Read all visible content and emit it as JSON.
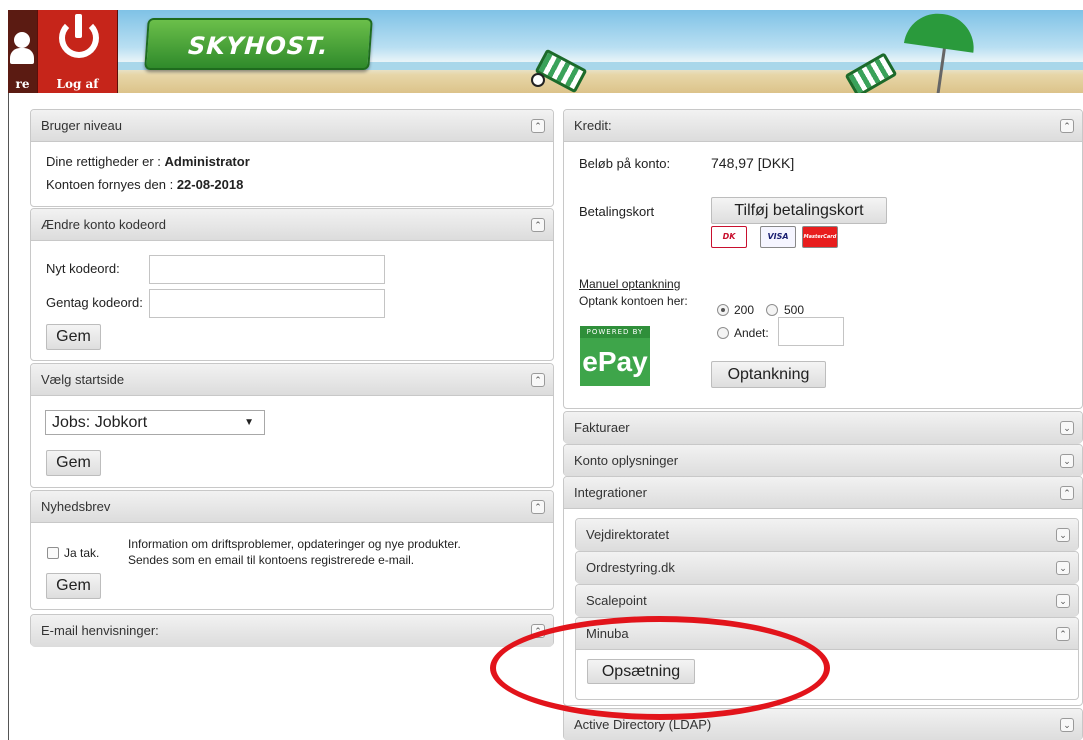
{
  "header": {
    "profile_label": "re",
    "logout_label": "Log af",
    "logo_text": "SKYHOST."
  },
  "left": {
    "user_level": {
      "title": "Bruger niveau",
      "rights_label": "Dine rettigheder er :",
      "rights_value": "Administrator",
      "renew_label": "Kontoen fornyes den :",
      "renew_value": "22-08-2018"
    },
    "change_password": {
      "title": "Ændre konto kodeord",
      "new_label": "Nyt kodeord:",
      "repeat_label": "Gentag kodeord:",
      "save_label": "Gem"
    },
    "start_page": {
      "title": "Vælg startside",
      "selected": "Jobs: Jobkort",
      "save_label": "Gem"
    },
    "newsletter": {
      "title": "Nyhedsbrev",
      "checkbox_label": "Ja tak.",
      "line1": "Information om driftsproblemer, opdateringer og nye produkter.",
      "line2": "Sendes som en email til kontoens registrerede e-mail.",
      "save_label": "Gem"
    },
    "email_refs": {
      "title": "E-mail henvisninger:"
    }
  },
  "right": {
    "credit": {
      "title": "Kredit:",
      "balance_label": "Beløb på konto:",
      "balance_value": "748,97 [DKK]",
      "cards_label": "Betalingskort",
      "add_card_label": "Tilføj betalingskort",
      "card_logos": [
        "DK",
        "VISA",
        "MasterCard"
      ],
      "manual_link": "Manuel optankning",
      "topup_label": "Optank kontoen her:",
      "option_200": "200",
      "option_500": "500",
      "option_other": "Andet:",
      "epay_top": "POWERED BY",
      "epay_text": "ePay",
      "topup_button": "Optankning"
    },
    "invoices": {
      "title": "Fakturaer"
    },
    "account_info": {
      "title": "Konto oplysninger"
    },
    "integrations": {
      "title": "Integrationer",
      "items": [
        {
          "title": "Vejdirektoratet"
        },
        {
          "title": "Ordrestyring.dk"
        },
        {
          "title": "Scalepoint"
        },
        {
          "title": "Minuba"
        }
      ],
      "setup_button": "Opsætning"
    },
    "ldap": {
      "title": "Active Directory (LDAP)"
    }
  },
  "icons": {
    "expanded": "chevron-up-icon",
    "collapsed": "chevron-down-icon"
  },
  "colors": {
    "logout_red": "#c6251a",
    "logo_green": "#3a9a36",
    "annotation_red": "#e2141b"
  }
}
